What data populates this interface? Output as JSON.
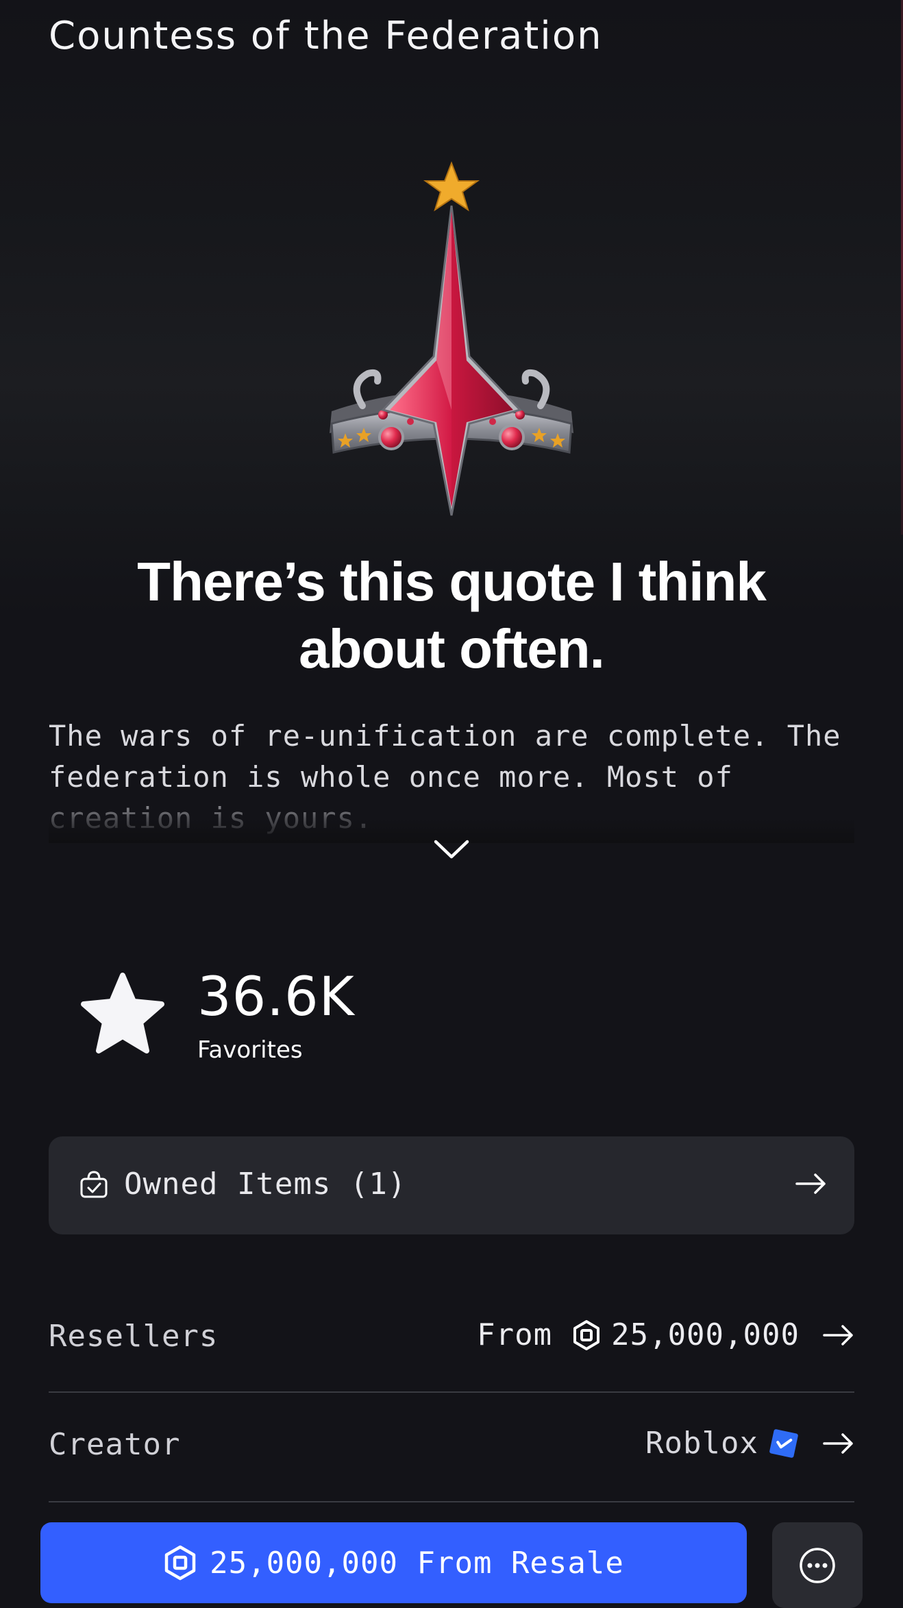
{
  "item": {
    "title": "Countess of the Federation",
    "headline": "There’s this quote I think about often.",
    "description": "The wars of re-unification are complete.  The federation is whole once more.  Most of creation is yours."
  },
  "favorites": {
    "count": "36.6K",
    "label": "Favorites"
  },
  "owned": {
    "label": "Owned Items (1)"
  },
  "resellers": {
    "label": "Resellers",
    "prefix": "From",
    "price": "25,000,000"
  },
  "creator": {
    "label": "Creator",
    "name": "Roblox",
    "verified": true
  },
  "buy_button": {
    "label": "25,000,000 From Resale"
  },
  "icons": {
    "expand": "chevron-down-icon",
    "favorite": "star-icon",
    "owned": "shopping-basket-icon",
    "arrow": "arrow-right-icon",
    "currency": "robux-icon",
    "verified": "verified-badge-icon",
    "more": "more-options-icon"
  },
  "colors": {
    "background": "#131318",
    "card": "#26272d",
    "accent": "#335fff",
    "verified": "#2f6cf6"
  }
}
